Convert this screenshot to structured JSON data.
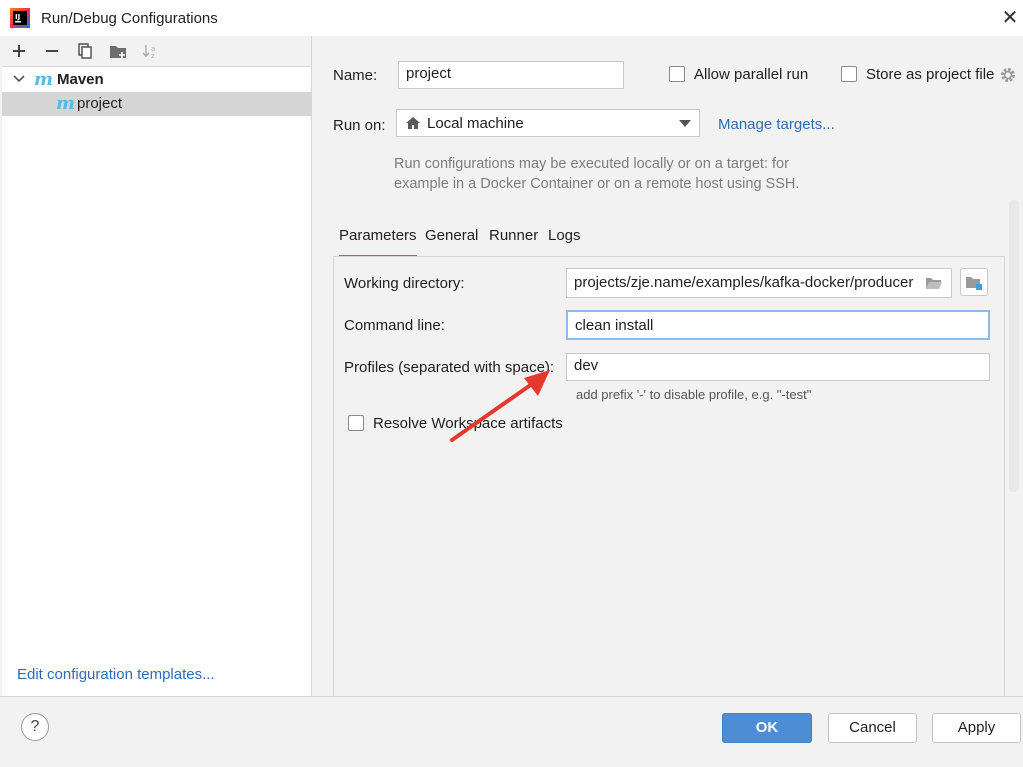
{
  "window": {
    "title": "Run/Debug Configurations"
  },
  "toolbar": {
    "icons": [
      "add-icon",
      "remove-icon",
      "copy-icon",
      "new-folder-icon",
      "sort-icon"
    ]
  },
  "tree": {
    "group_label": "Maven",
    "item_label": "project"
  },
  "left_footer": {
    "edit_templates": "Edit configuration templates..."
  },
  "form": {
    "name_label": "Name:",
    "name_value": "project",
    "allow_parallel_label": "Allow parallel run",
    "store_as_project_label": "Store as project file",
    "run_on_label": "Run on:",
    "run_on_value": "Local machine",
    "manage_targets": "Manage targets...",
    "hint_line1": "Run configurations may be executed locally or on a target: for",
    "hint_line2": "example in a Docker Container or on a remote host using SSH."
  },
  "tabs": [
    "Parameters",
    "General",
    "Runner",
    "Logs"
  ],
  "parameters": {
    "working_dir_label": "Working directory:",
    "working_dir_value": "projects/zje.name/examples/kafka-docker/producer",
    "command_line_label": "Command line:",
    "command_line_value": "clean install",
    "profiles_label": "Profiles (separated with space):",
    "profiles_value": "dev",
    "profiles_hint": "add prefix '-' to disable profile, e.g. \"-test\"",
    "resolve_label": "Resolve Workspace artifacts"
  },
  "buttons": {
    "help": "?",
    "ok": "OK",
    "cancel": "Cancel",
    "apply": "Apply"
  },
  "colors": {
    "accent": "#4d8dd5",
    "link": "#2f6cb5",
    "maven_icon": "#5bb7e5",
    "arrow": "#e5392e"
  }
}
